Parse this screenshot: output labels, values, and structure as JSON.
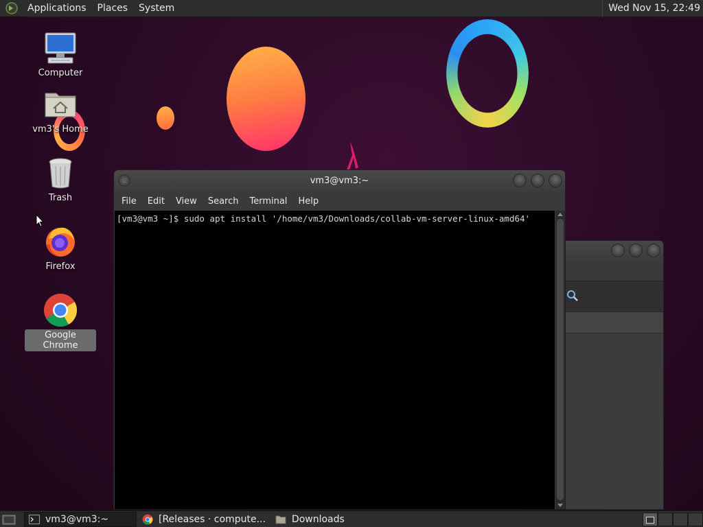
{
  "top_panel": {
    "menus": [
      "Applications",
      "Places",
      "System"
    ],
    "clock": "Wed Nov 15, 22:49"
  },
  "desktop": {
    "icons": [
      {
        "label": "Computer",
        "icon": "computer-icon"
      },
      {
        "label": "vm3's Home",
        "icon": "home-folder-icon"
      },
      {
        "label": "Trash",
        "icon": "trash-icon"
      },
      {
        "label": "Firefox",
        "icon": "firefox-icon"
      },
      {
        "label": "Google Chrome",
        "icon": "chrome-icon",
        "selected": true
      }
    ]
  },
  "terminal": {
    "title": "vm3@vm3:~",
    "menu": [
      "File",
      "Edit",
      "View",
      "Search",
      "Terminal",
      "Help"
    ],
    "line": "[vm3@vm3 ~]$ sudo apt install '/home/vm3/Downloads/collab-vm-server-linux-amd64'"
  },
  "taskbar": {
    "tasks": [
      {
        "label": "vm3@vm3:~",
        "icon": "terminal-icon",
        "active": true
      },
      {
        "label": "[Releases · compute...",
        "icon": "chrome-icon",
        "active": false
      },
      {
        "label": "Downloads",
        "icon": "folder-icon",
        "active": false
      }
    ]
  },
  "colors": {
    "desktop_bg": "#2b0a26",
    "panel_bg": "#2d2d2d",
    "terminal_bg": "#000000"
  }
}
